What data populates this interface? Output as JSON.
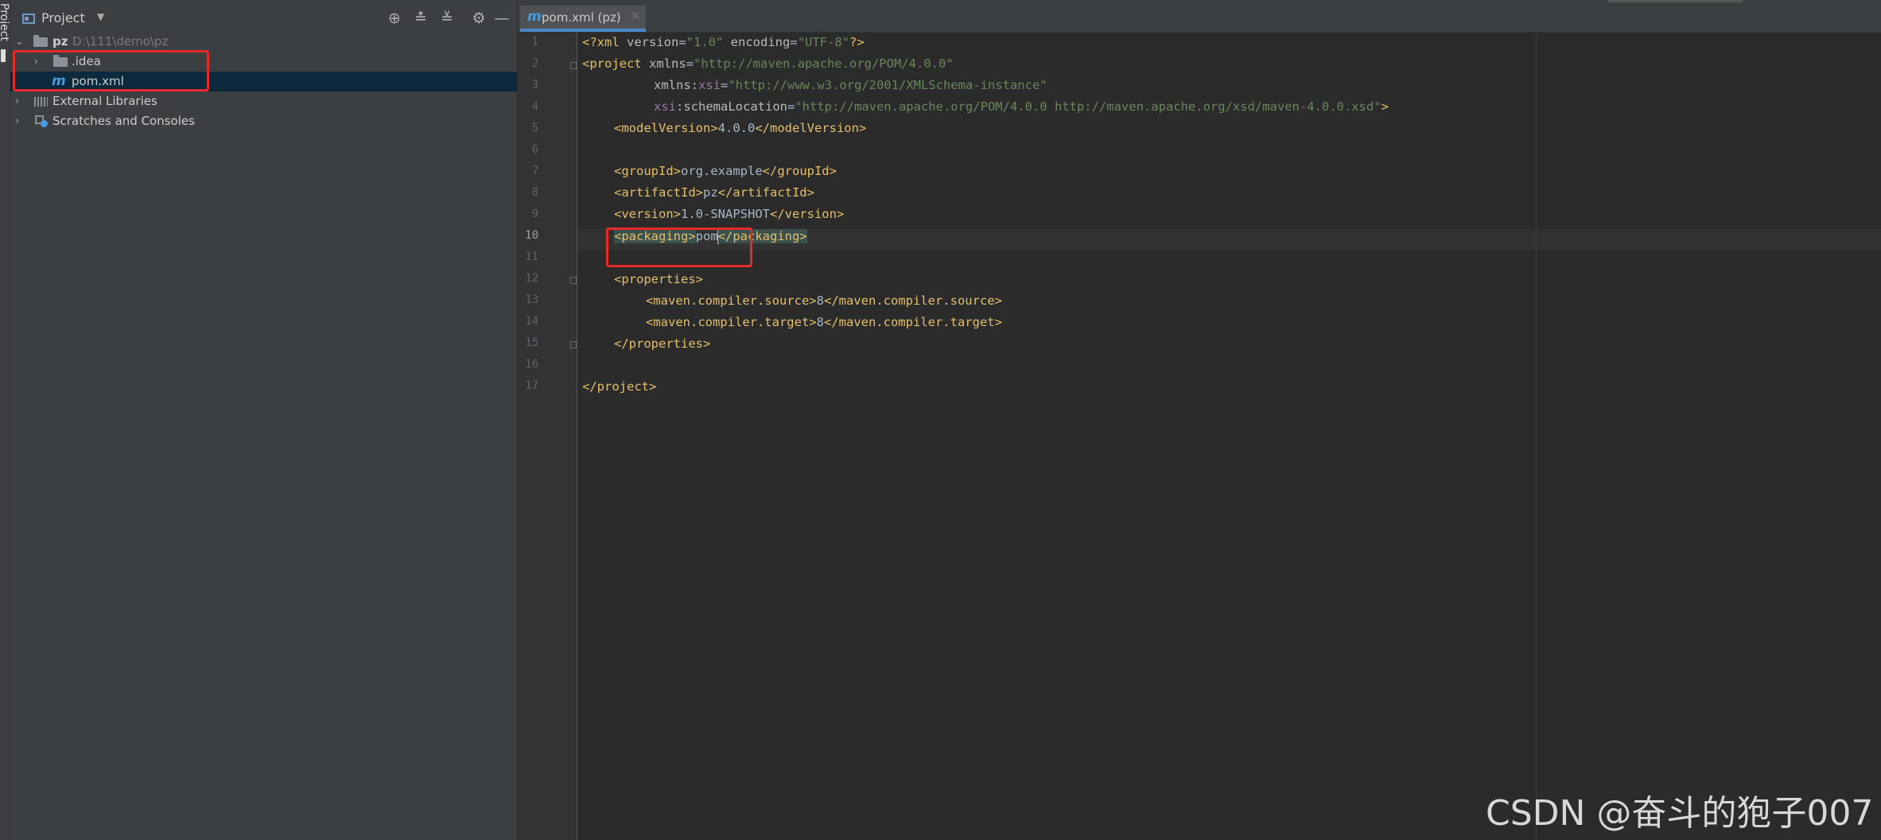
{
  "sidebar_stripe": {
    "label": "Project"
  },
  "project_panel": {
    "title": "Project",
    "tree": {
      "root": {
        "name": "pz",
        "path": "D:\\111\\demo\\pz"
      },
      "idea": ".idea",
      "pom": "pom.xml",
      "external_libraries": "External Libraries",
      "scratches": "Scratches and Consoles"
    }
  },
  "editor": {
    "tab": {
      "label": "pom.xml (pz)",
      "close": "×"
    },
    "line_numbers": [
      "1",
      "2",
      "3",
      "4",
      "5",
      "6",
      "7",
      "8",
      "9",
      "10",
      "11",
      "12",
      "13",
      "14",
      "15",
      "16",
      "17"
    ],
    "current_line": "10",
    "code": {
      "l1": {
        "open": "<?xml",
        "a1": " version",
        "eq1": "=",
        "v1": "\"1.0\"",
        "a2": " encoding",
        "eq2": "=",
        "v2": "\"UTF-8\"",
        "close": "?>"
      },
      "l2": {
        "tag": "<project",
        "attr": " xmlns",
        "eq": "=",
        "val": "\"http://maven.apache.org/POM/4.0.0\""
      },
      "l3": {
        "pre": "xmlns:",
        "ns": "xsi",
        "eq": "=",
        "val": "\"http://www.w3.org/2001/XMLSchema-instance\""
      },
      "l4": {
        "ns": "xsi",
        "attr": ":schemaLocation",
        "eq": "=",
        "val": "\"http://maven.apache.org/POM/4.0.0 http://maven.apache.org/xsd/maven-4.0.0.xsd\"",
        "close": ">"
      },
      "l5": {
        "open": "<modelVersion>",
        "text": "4.0.0",
        "close": "</modelVersion>"
      },
      "l7": {
        "open": "<groupId>",
        "text": "org.example",
        "close": "</groupId>"
      },
      "l8": {
        "open": "<artifactId>",
        "text": "pz",
        "close": "</artifactId>"
      },
      "l9": {
        "open": "<version>",
        "text": "1.0-SNAPSHOT",
        "close": "</version>"
      },
      "l10": {
        "open": "<packaging>",
        "text": "pom",
        "close": "</packaging>"
      },
      "l12": {
        "open": "<properties>"
      },
      "l13": {
        "open": "<maven.compiler.source>",
        "text": "8",
        "close": "</maven.compiler.source>"
      },
      "l14": {
        "open": "<maven.compiler.target>",
        "text": "8",
        "close": "</maven.compiler.target>"
      },
      "l15": {
        "close": "</properties>"
      },
      "l17": {
        "close": "</project>"
      }
    }
  },
  "watermark": "CSDN @奋斗的狍子007",
  "colors": {
    "background": "#2b2b2b",
    "panel": "#3c3f41",
    "selection": "#0d293e",
    "tag": "#e8bf6a",
    "attr_value": "#6a8759",
    "namespace": "#9876aa",
    "annotation_box": "#e52a2a"
  }
}
